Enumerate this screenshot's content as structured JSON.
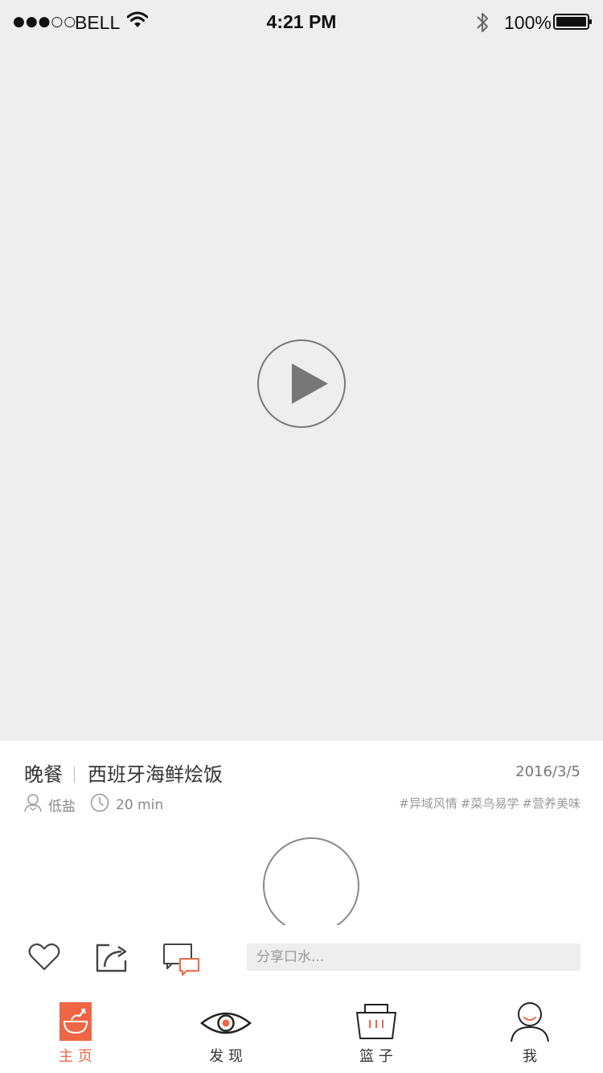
{
  "status_bar": {
    "signal": "●●●○○",
    "carrier": "BELL",
    "time": "4:21 PM",
    "battery": "100%"
  },
  "recipe": {
    "meal": "晚餐",
    "name": "西班牙海鲜烩饭",
    "date": "2016/3/5",
    "diet": "低盐",
    "duration": "20 min",
    "tags": [
      "#异域风情",
      "#菜鸟易学",
      "#营养美味"
    ]
  },
  "comment": {
    "placeholder": "分享口水..."
  },
  "tabs": [
    {
      "label": "主 页",
      "icon": "bowl-icon",
      "active": true
    },
    {
      "label": "发 现",
      "icon": "eye-icon",
      "active": false
    },
    {
      "label": "篮 子",
      "icon": "basket-icon",
      "active": false
    },
    {
      "label": "我",
      "icon": "user-icon",
      "active": false
    }
  ],
  "colors": {
    "accent": "#ee6645",
    "background_gray": "#eeeeee",
    "text_dark": "#333333",
    "text_muted": "#999999"
  }
}
